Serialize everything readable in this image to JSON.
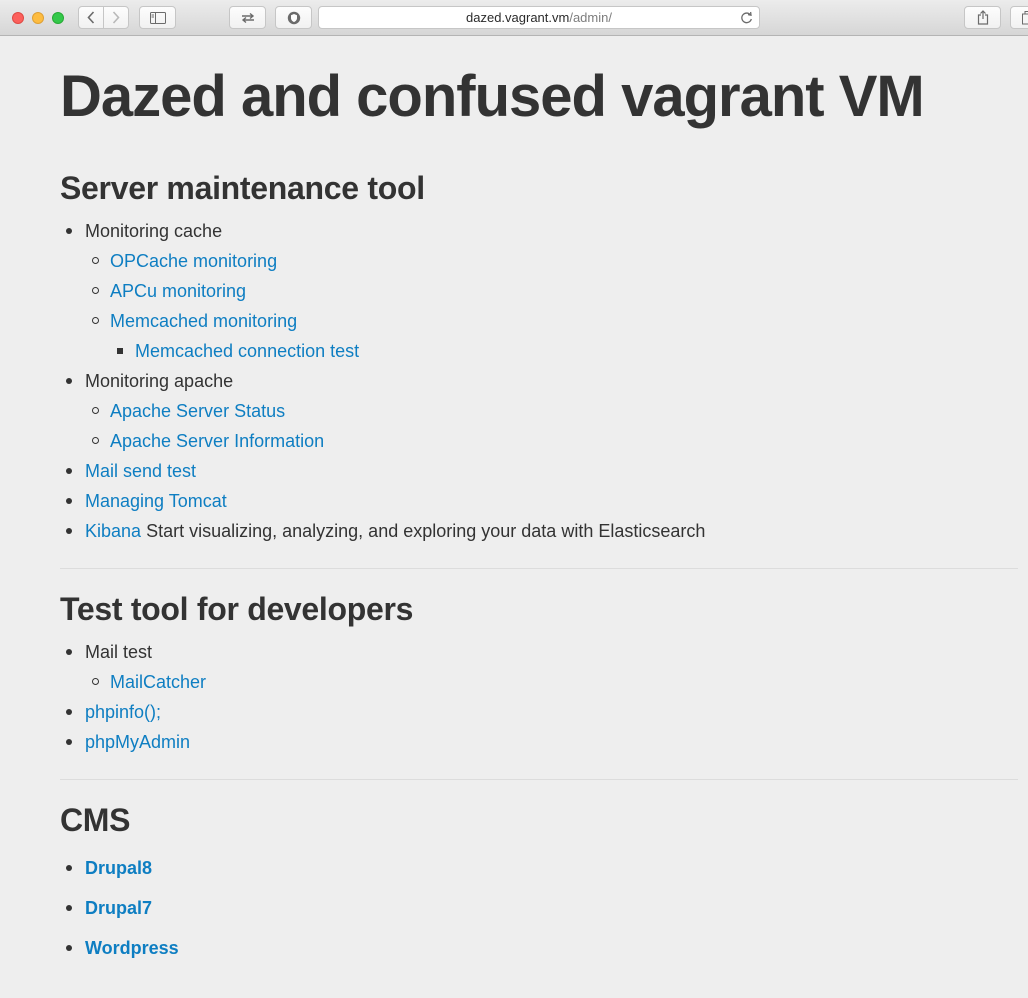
{
  "browser": {
    "url_host": "dazed.vagrant.vm",
    "url_path": "/admin/"
  },
  "page": {
    "title": "Dazed and confused vagrant VM",
    "sections": {
      "server": {
        "heading": "Server maintenance tool",
        "monitoring_cache": "Monitoring cache",
        "opcache": "OPCache monitoring",
        "apcu": "APCu monitoring",
        "memcached": "Memcached monitoring",
        "memcached_test": "Memcached connection test",
        "monitoring_apache": "Monitoring apache",
        "apache_status": "Apache Server Status",
        "apache_info": "Apache Server Information",
        "mail_send": "Mail send test",
        "tomcat": "Managing Tomcat",
        "kibana": "Kibana",
        "kibana_desc": "Start visualizing, analyzing, and exploring your data with Elasticsearch"
      },
      "dev": {
        "heading": "Test tool for developers",
        "mail_test": "Mail test",
        "mailcatcher": "MailCatcher",
        "phpinfo": "phpinfo();",
        "phpmyadmin": "phpMyAdmin"
      },
      "cms": {
        "heading": "CMS",
        "drupal8": "Drupal8",
        "drupal7": "Drupal7",
        "wordpress": "Wordpress"
      }
    }
  },
  "colors": {
    "link": "#0e7ec2",
    "text": "#333333",
    "background": "#eeeeee"
  }
}
